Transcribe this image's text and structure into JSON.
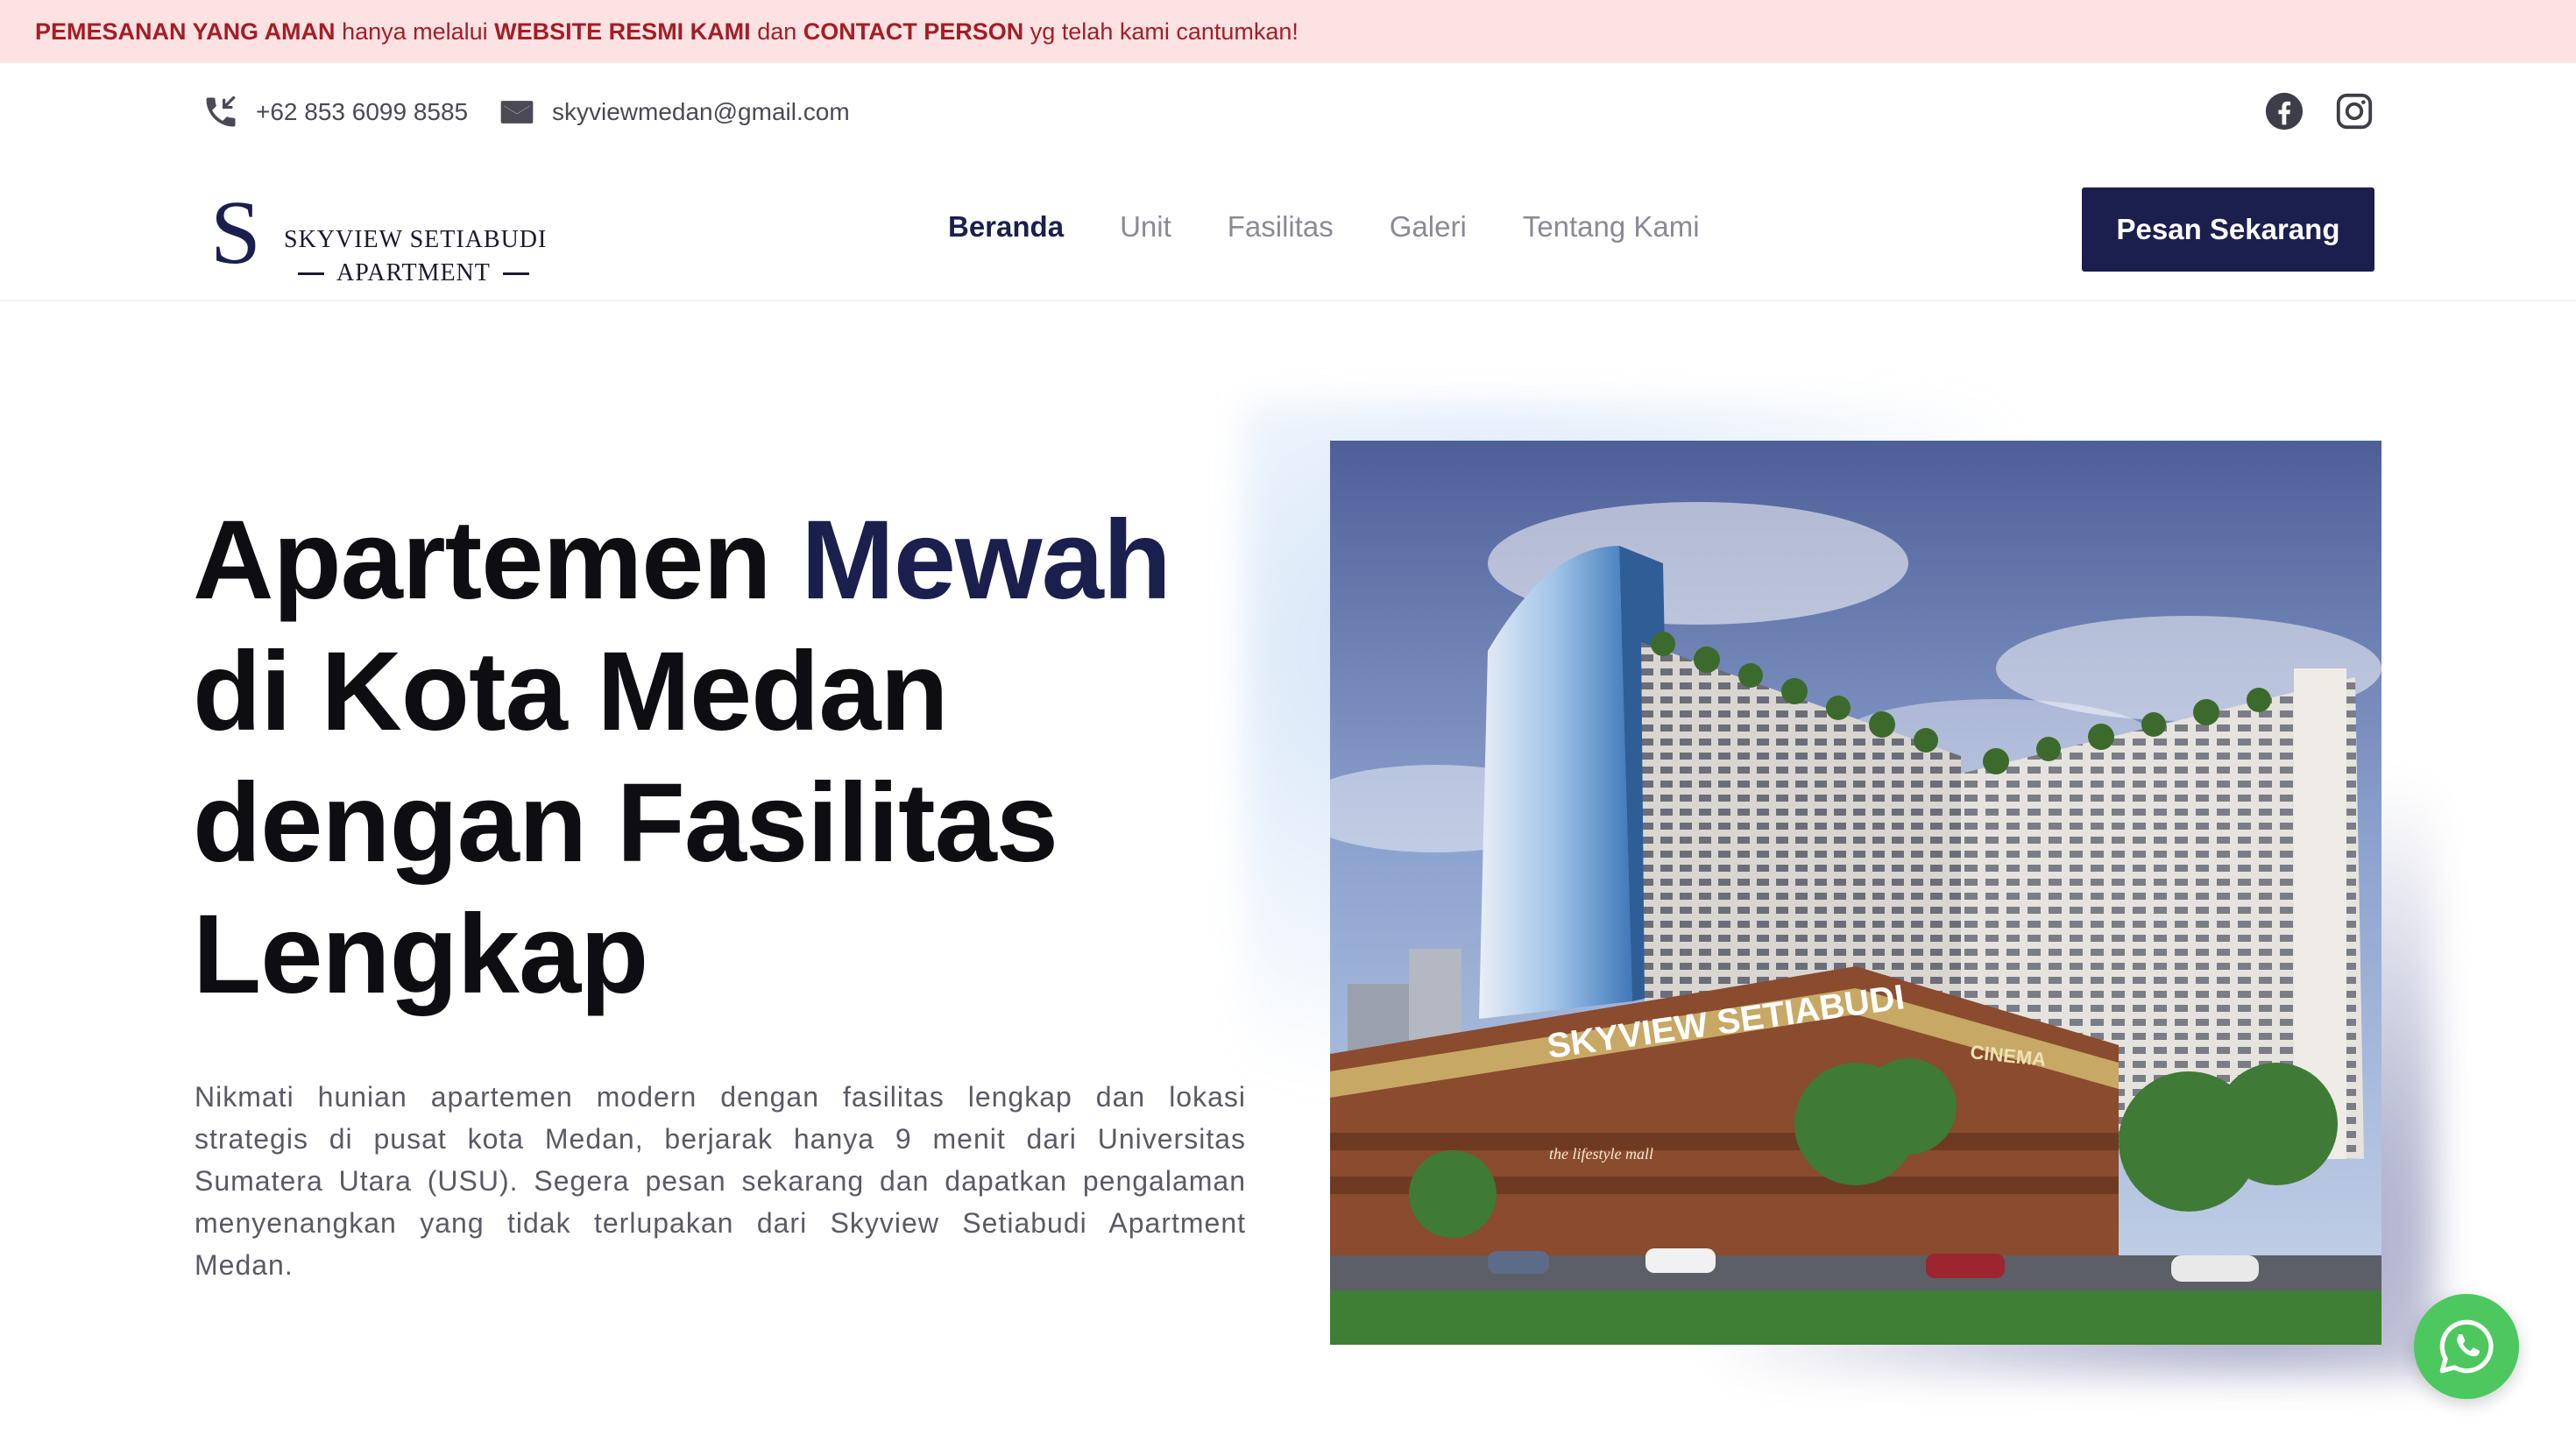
{
  "notice": {
    "part1": "PEMESANAN YANG AMAN",
    "part2": " hanya melalui ",
    "part3": "WEBSITE RESMI KAMI",
    "part4": " dan ",
    "part5": "CONTACT PERSON",
    "part6": " yg telah kami cantumkan!"
  },
  "contact": {
    "phone": "+62 853 6099 8585",
    "email": "skyviewmedan@gmail.com",
    "phone_icon": "phone-incoming-icon",
    "email_icon": "mail-icon"
  },
  "social": {
    "facebook_icon": "facebook-icon",
    "instagram_icon": "instagram-icon"
  },
  "logo": {
    "line1": "SKYVIEW SETIABUDI",
    "line2": "APARTMENT",
    "mark": "S"
  },
  "nav": {
    "items": [
      {
        "label": "Beranda",
        "active": true
      },
      {
        "label": "Unit",
        "active": false
      },
      {
        "label": "Fasilitas",
        "active": false
      },
      {
        "label": "Galeri",
        "active": false
      },
      {
        "label": "Tentang Kami",
        "active": false
      }
    ],
    "cta_label": "Pesan Sekarang"
  },
  "hero": {
    "title_part1": "Apartemen ",
    "title_accent": "Mewah",
    "title_line2": "di Kota Medan",
    "title_line3": "dengan Fasilitas",
    "title_line4": "Lengkap",
    "description": "Nikmati hunian apartemen modern dengan fasilitas lengkap dan lokasi strategis di pusat kota Medan, berjarak hanya 9 menit dari Universitas Sumatera Utara (USU). Segera pesan sekarang dan dapatkan pengalaman menyenangkan yang tidak terlupakan dari Skyview Setiabudi Apartment Medan.",
    "image_sign": "SKYVIEW SETIABUDI",
    "image_sign2": "CINEMA",
    "image_sign3": "the lifestyle mall"
  },
  "colors": {
    "brand": "#1b1f4e",
    "notice_bg": "#fde2e4",
    "notice_text": "#a51d24",
    "whatsapp": "#4cc85e"
  }
}
